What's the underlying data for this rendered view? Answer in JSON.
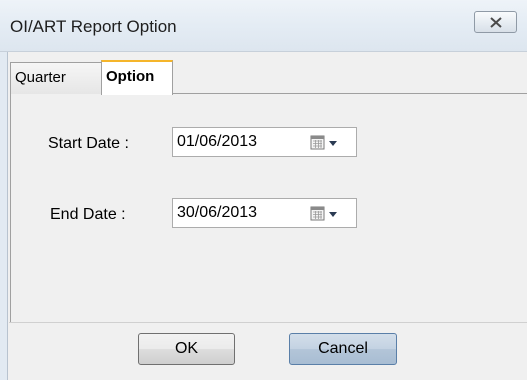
{
  "window": {
    "title": "OI/ART Report Option"
  },
  "tabs": [
    {
      "label": "Quarter",
      "selected": false
    },
    {
      "label": "Option",
      "selected": true
    }
  ],
  "form": {
    "start_date_label": "Start Date :",
    "start_date_value": "01/06/2013",
    "end_date_label": "End Date :",
    "end_date_value": "30/06/2013"
  },
  "buttons": {
    "ok_label": "OK",
    "cancel_label": "Cancel"
  },
  "icons": {
    "close": "close-icon",
    "calendar": "calendar-icon",
    "dropdown": "chevron-down-icon"
  },
  "colors": {
    "active_tab_accent": "#f5b52a",
    "cancel_button": "#b3c5d8"
  }
}
